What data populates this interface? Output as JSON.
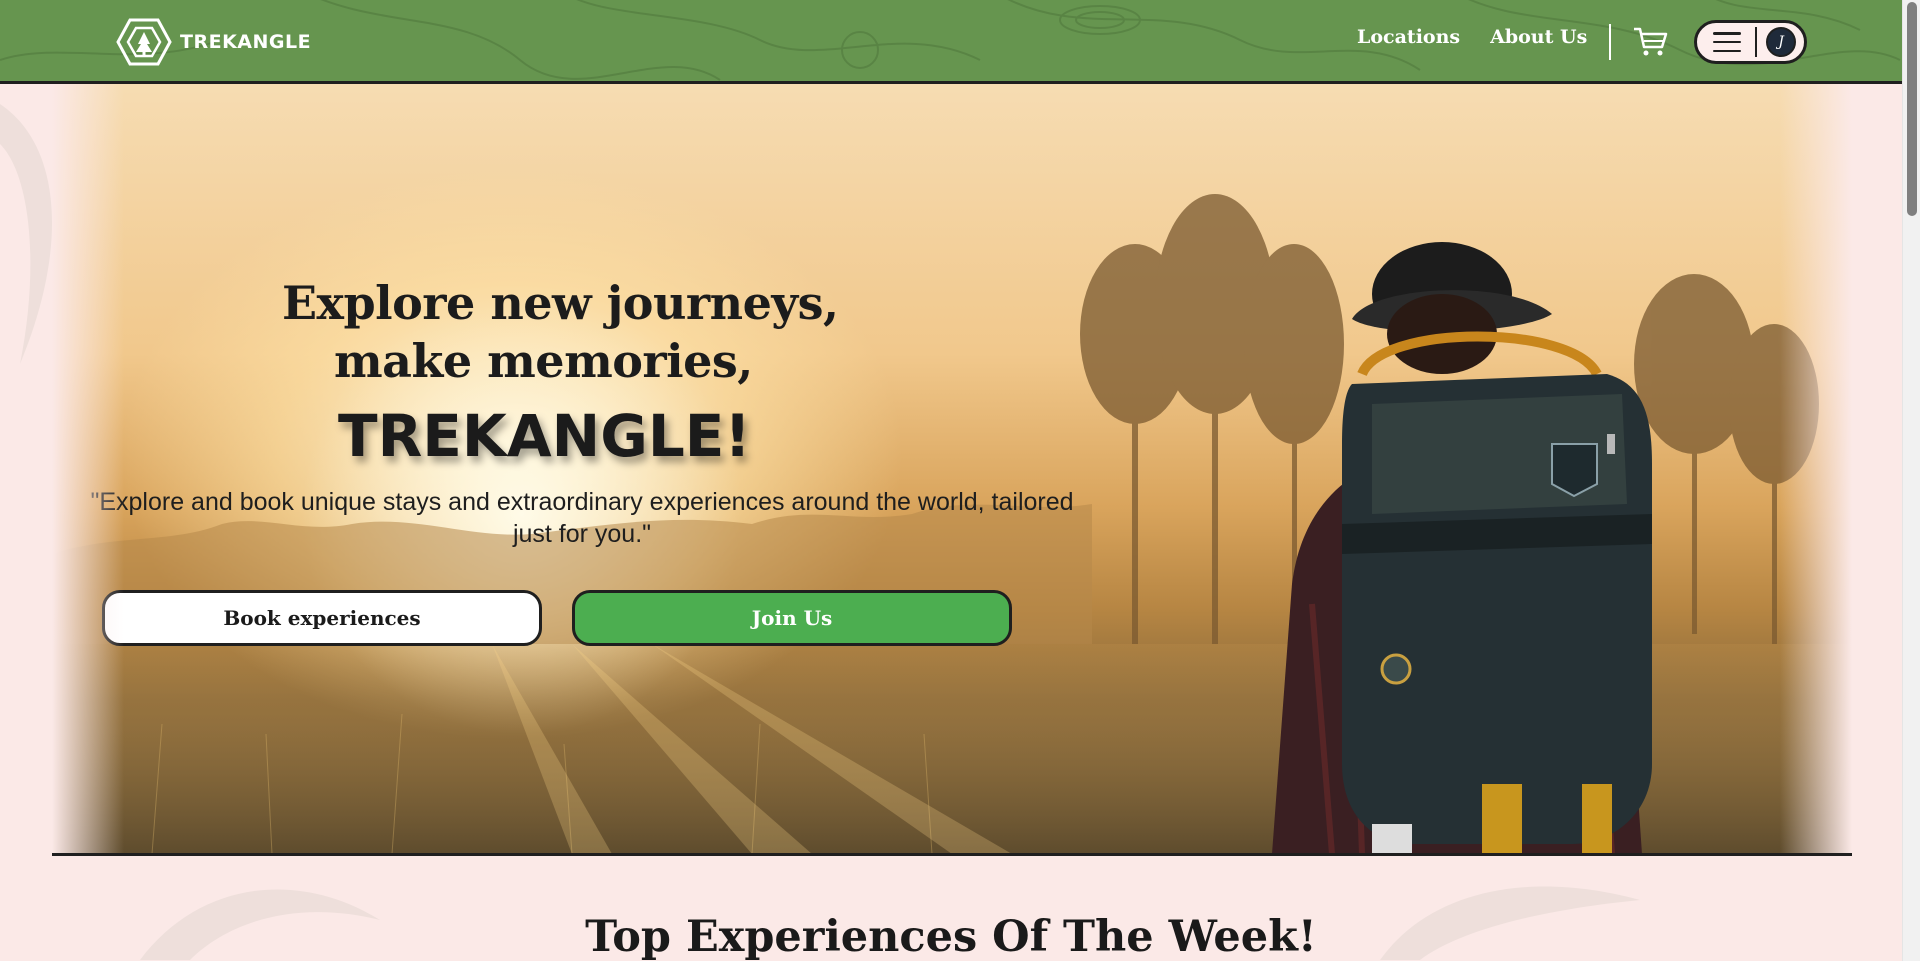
{
  "navbar": {
    "brand_name": "TREKANGLE",
    "links": [
      "Locations",
      "About Us"
    ],
    "icons": {
      "logo": "hexagon-tree-logo",
      "cart": "cart-icon",
      "menu": "hamburger-icon",
      "profile": "avatar-icon"
    },
    "avatar_initial": "J",
    "bg_color": "#66954f"
  },
  "hero": {
    "title_line1": "Explore new journeys,",
    "title_line2": "make memories,",
    "brand_line": "TREKANGLE!",
    "quote": "\"Explore and book unique stays and extraordinary experiences around the world, tailored just for you.\"",
    "buttons": {
      "book": "Book experiences",
      "join": "Join Us"
    },
    "join_color": "#4cae50"
  },
  "section": {
    "title": "Top Experiences Of The Week!"
  },
  "page_bg": "#fbe9e7"
}
